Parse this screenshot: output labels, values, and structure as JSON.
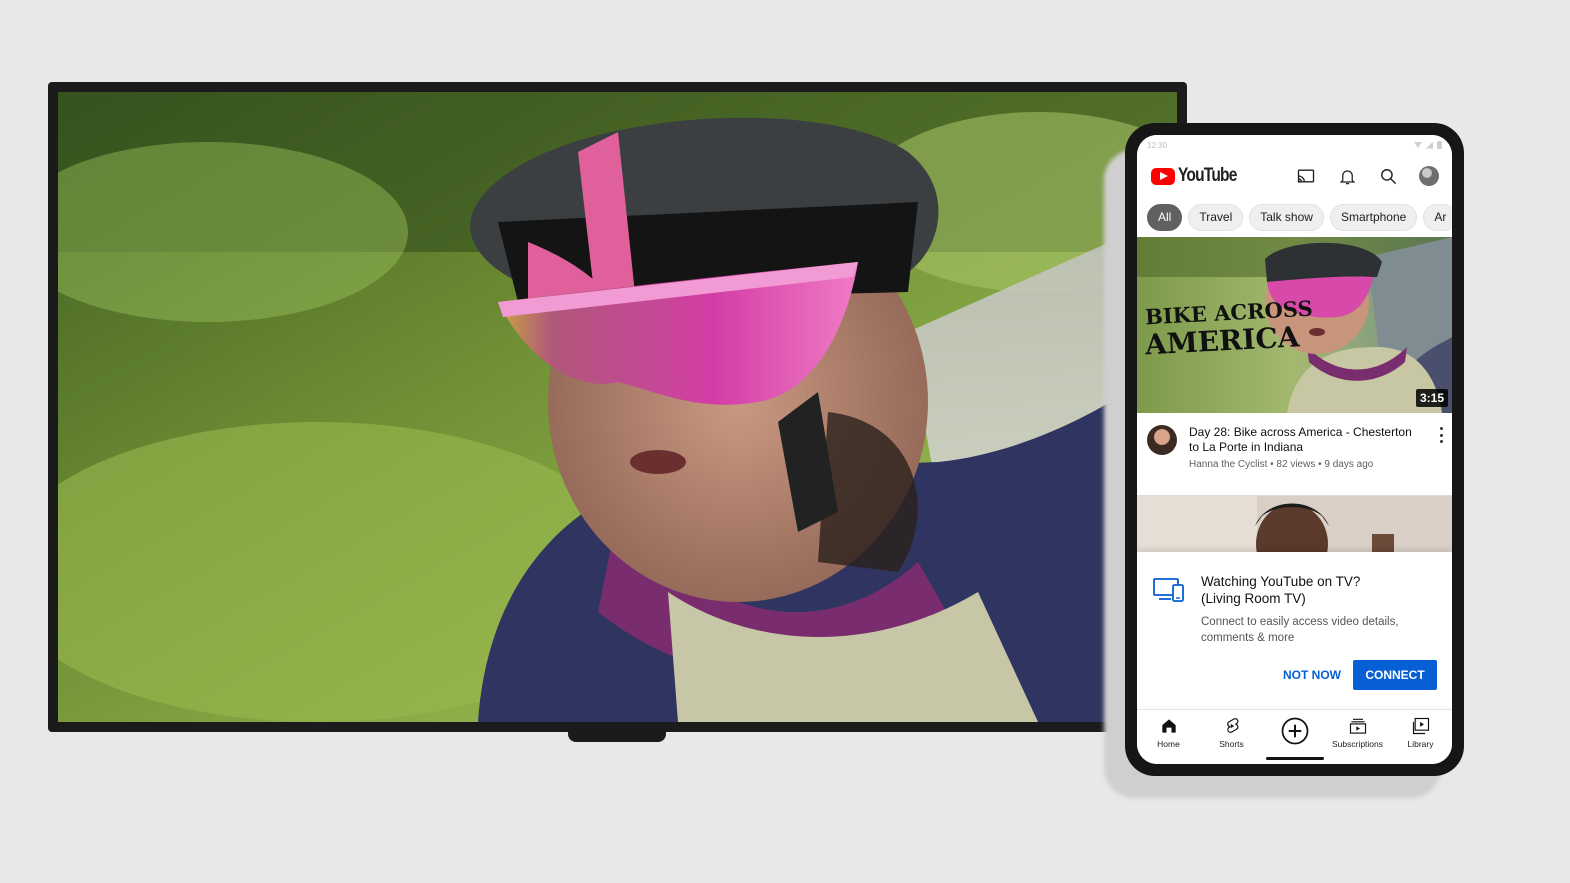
{
  "colors": {
    "brand_red": "#ff0000",
    "accent_blue": "#065fd4",
    "background": "#e8e8e8"
  },
  "tv": {
    "content": "cyclist-video-playback"
  },
  "phone": {
    "status": {
      "time": "12:30"
    },
    "app": {
      "logo_text": "YouTube"
    },
    "topbar": {
      "icons": [
        "cast-icon",
        "bell-icon",
        "search-icon",
        "account-avatar"
      ]
    },
    "chips": [
      "All",
      "Travel",
      "Talk show",
      "Smartphone",
      "Ar"
    ],
    "active_chip": "All",
    "video": {
      "thumbnail_text_line1": "BIKE ACROSS",
      "thumbnail_text_line2": "AMERICA",
      "duration": "3:15",
      "title": "Day 28: Bike across America - Chesterton to La Porte in Indiana",
      "channel": "Hanna the Cyclist",
      "views": "82 views",
      "age": "9 days ago",
      "subtitle": "Hanna the Cyclist • 82 views • 9 days ago"
    },
    "connect_card": {
      "title_line1": "Watching YouTube on TV?",
      "title_line2": "(Living Room TV)",
      "body": "Connect to easily access video details, comments & more",
      "not_now": "NOT NOW",
      "connect": "CONNECT"
    },
    "bottom_nav": {
      "home": "Home",
      "shorts": "Shorts",
      "subscriptions": "Subscriptions",
      "library": "Library"
    }
  }
}
